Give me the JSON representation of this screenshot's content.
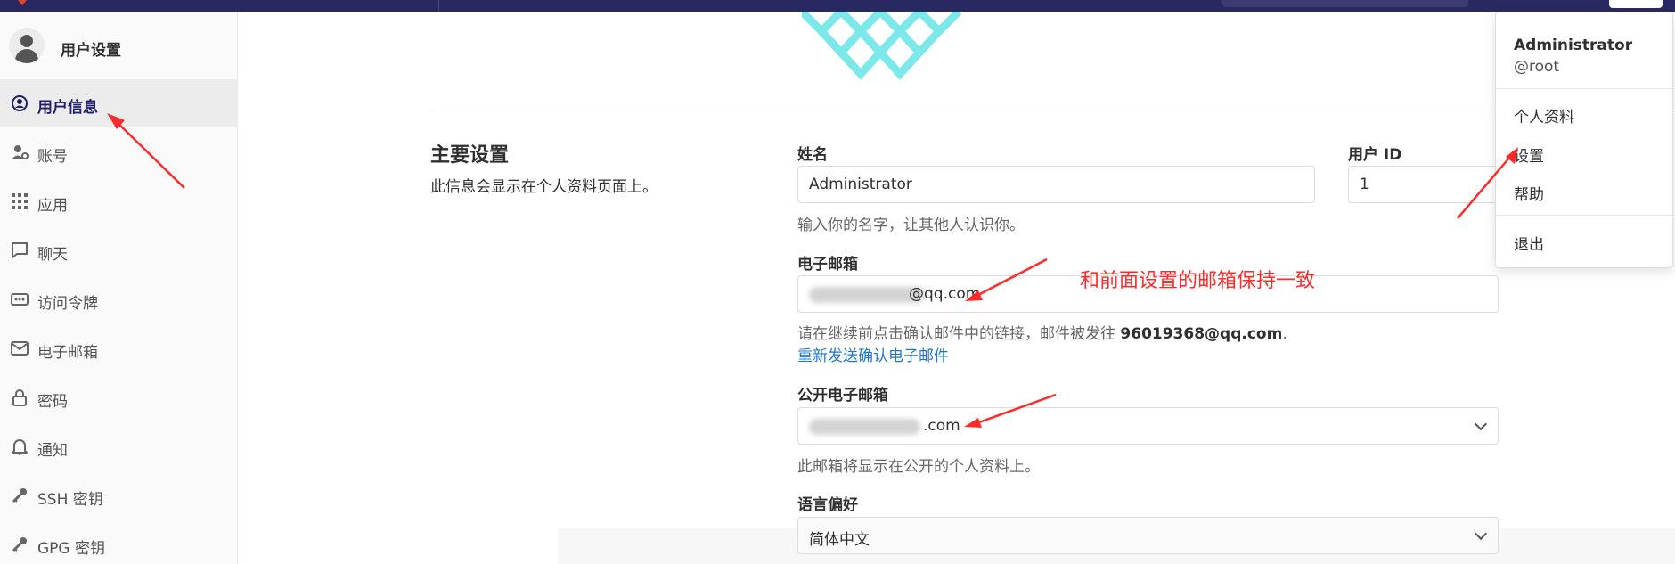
{
  "sidebar": {
    "title": "用户设置",
    "items": [
      {
        "label": "用户信息",
        "icon": "user-circle-icon",
        "active": true
      },
      {
        "label": "账号",
        "icon": "account-icon"
      },
      {
        "label": "应用",
        "icon": "apps-grid-icon"
      },
      {
        "label": "聊天",
        "icon": "chat-bubble-icon"
      },
      {
        "label": "访问令牌",
        "icon": "token-icon"
      },
      {
        "label": "电子邮箱",
        "icon": "mail-icon"
      },
      {
        "label": "密码",
        "icon": "lock-icon"
      },
      {
        "label": "通知",
        "icon": "bell-icon"
      },
      {
        "label": "SSH 密钥",
        "icon": "key-icon"
      },
      {
        "label": "GPG 密钥",
        "icon": "key-icon"
      }
    ]
  },
  "main": {
    "section_title": "主要设置",
    "section_desc": "此信息会显示在个人资料页面上。",
    "name": {
      "label": "姓名",
      "value": "Administrator",
      "help": "输入你的名字，让其他人认识你。"
    },
    "user_id": {
      "label": "用户 ID",
      "value": "1"
    },
    "email": {
      "label": "电子邮箱",
      "value_suffix": "@qq.com",
      "help_prefix": "请在继续前点击确认邮件中的链接，邮件被发往",
      "help_email": "96019368@qq.com",
      "help_suffix": ".",
      "resend_link": "重新发送确认电子邮件"
    },
    "public_email": {
      "label": "公开电子邮箱",
      "value_suffix": ".com",
      "help": "此邮箱将显示在公开的个人资料上。"
    },
    "language": {
      "label": "语言偏好",
      "value": "简体中文"
    }
  },
  "annotation": {
    "text": "和前面设置的邮箱保持一致",
    "color": "#ff2b2b"
  },
  "dropdown": {
    "name": "Administrator",
    "username": "@root",
    "items": [
      "个人资料",
      "设置",
      "帮助"
    ],
    "signout": "退出"
  },
  "colors": {
    "topbar": "#292961",
    "accent": "#1f1f6b",
    "link": "#1f75cb",
    "annotation": "#ff2b2b"
  }
}
